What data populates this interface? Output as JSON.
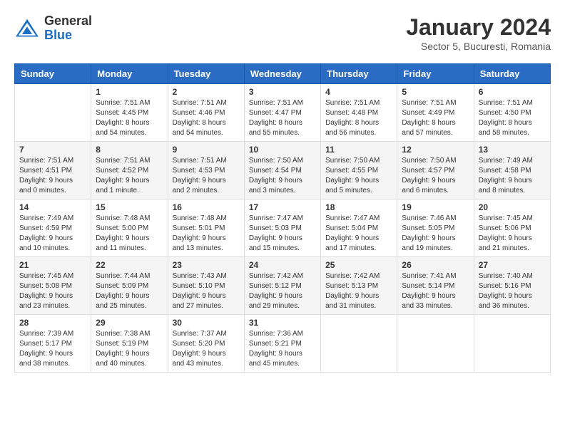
{
  "logo": {
    "general": "General",
    "blue": "Blue"
  },
  "title": "January 2024",
  "location": "Sector 5, Bucuresti, Romania",
  "weekdays": [
    "Sunday",
    "Monday",
    "Tuesday",
    "Wednesday",
    "Thursday",
    "Friday",
    "Saturday"
  ],
  "weeks": [
    [
      {
        "day": "",
        "info": ""
      },
      {
        "day": "1",
        "info": "Sunrise: 7:51 AM\nSunset: 4:45 PM\nDaylight: 8 hours\nand 54 minutes."
      },
      {
        "day": "2",
        "info": "Sunrise: 7:51 AM\nSunset: 4:46 PM\nDaylight: 8 hours\nand 54 minutes."
      },
      {
        "day": "3",
        "info": "Sunrise: 7:51 AM\nSunset: 4:47 PM\nDaylight: 8 hours\nand 55 minutes."
      },
      {
        "day": "4",
        "info": "Sunrise: 7:51 AM\nSunset: 4:48 PM\nDaylight: 8 hours\nand 56 minutes."
      },
      {
        "day": "5",
        "info": "Sunrise: 7:51 AM\nSunset: 4:49 PM\nDaylight: 8 hours\nand 57 minutes."
      },
      {
        "day": "6",
        "info": "Sunrise: 7:51 AM\nSunset: 4:50 PM\nDaylight: 8 hours\nand 58 minutes."
      }
    ],
    [
      {
        "day": "7",
        "info": "Sunrise: 7:51 AM\nSunset: 4:51 PM\nDaylight: 9 hours\nand 0 minutes."
      },
      {
        "day": "8",
        "info": "Sunrise: 7:51 AM\nSunset: 4:52 PM\nDaylight: 9 hours\nand 1 minute."
      },
      {
        "day": "9",
        "info": "Sunrise: 7:51 AM\nSunset: 4:53 PM\nDaylight: 9 hours\nand 2 minutes."
      },
      {
        "day": "10",
        "info": "Sunrise: 7:50 AM\nSunset: 4:54 PM\nDaylight: 9 hours\nand 3 minutes."
      },
      {
        "day": "11",
        "info": "Sunrise: 7:50 AM\nSunset: 4:55 PM\nDaylight: 9 hours\nand 5 minutes."
      },
      {
        "day": "12",
        "info": "Sunrise: 7:50 AM\nSunset: 4:57 PM\nDaylight: 9 hours\nand 6 minutes."
      },
      {
        "day": "13",
        "info": "Sunrise: 7:49 AM\nSunset: 4:58 PM\nDaylight: 9 hours\nand 8 minutes."
      }
    ],
    [
      {
        "day": "14",
        "info": "Sunrise: 7:49 AM\nSunset: 4:59 PM\nDaylight: 9 hours\nand 10 minutes."
      },
      {
        "day": "15",
        "info": "Sunrise: 7:48 AM\nSunset: 5:00 PM\nDaylight: 9 hours\nand 11 minutes."
      },
      {
        "day": "16",
        "info": "Sunrise: 7:48 AM\nSunset: 5:01 PM\nDaylight: 9 hours\nand 13 minutes."
      },
      {
        "day": "17",
        "info": "Sunrise: 7:47 AM\nSunset: 5:03 PM\nDaylight: 9 hours\nand 15 minutes."
      },
      {
        "day": "18",
        "info": "Sunrise: 7:47 AM\nSunset: 5:04 PM\nDaylight: 9 hours\nand 17 minutes."
      },
      {
        "day": "19",
        "info": "Sunrise: 7:46 AM\nSunset: 5:05 PM\nDaylight: 9 hours\nand 19 minutes."
      },
      {
        "day": "20",
        "info": "Sunrise: 7:45 AM\nSunset: 5:06 PM\nDaylight: 9 hours\nand 21 minutes."
      }
    ],
    [
      {
        "day": "21",
        "info": "Sunrise: 7:45 AM\nSunset: 5:08 PM\nDaylight: 9 hours\nand 23 minutes."
      },
      {
        "day": "22",
        "info": "Sunrise: 7:44 AM\nSunset: 5:09 PM\nDaylight: 9 hours\nand 25 minutes."
      },
      {
        "day": "23",
        "info": "Sunrise: 7:43 AM\nSunset: 5:10 PM\nDaylight: 9 hours\nand 27 minutes."
      },
      {
        "day": "24",
        "info": "Sunrise: 7:42 AM\nSunset: 5:12 PM\nDaylight: 9 hours\nand 29 minutes."
      },
      {
        "day": "25",
        "info": "Sunrise: 7:42 AM\nSunset: 5:13 PM\nDaylight: 9 hours\nand 31 minutes."
      },
      {
        "day": "26",
        "info": "Sunrise: 7:41 AM\nSunset: 5:14 PM\nDaylight: 9 hours\nand 33 minutes."
      },
      {
        "day": "27",
        "info": "Sunrise: 7:40 AM\nSunset: 5:16 PM\nDaylight: 9 hours\nand 36 minutes."
      }
    ],
    [
      {
        "day": "28",
        "info": "Sunrise: 7:39 AM\nSunset: 5:17 PM\nDaylight: 9 hours\nand 38 minutes."
      },
      {
        "day": "29",
        "info": "Sunrise: 7:38 AM\nSunset: 5:19 PM\nDaylight: 9 hours\nand 40 minutes."
      },
      {
        "day": "30",
        "info": "Sunrise: 7:37 AM\nSunset: 5:20 PM\nDaylight: 9 hours\nand 43 minutes."
      },
      {
        "day": "31",
        "info": "Sunrise: 7:36 AM\nSunset: 5:21 PM\nDaylight: 9 hours\nand 45 minutes."
      },
      {
        "day": "",
        "info": ""
      },
      {
        "day": "",
        "info": ""
      },
      {
        "day": "",
        "info": ""
      }
    ]
  ]
}
